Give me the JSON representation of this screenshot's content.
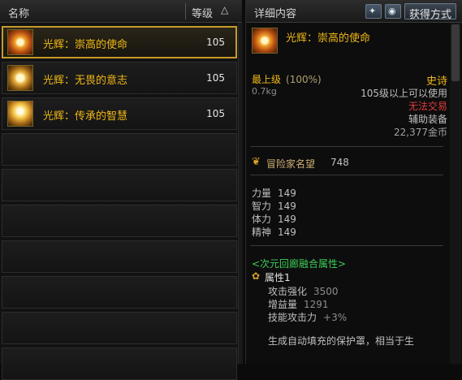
{
  "left_panel": {
    "header": {
      "name_label": "名称",
      "level_label": "等级",
      "sort_arrow": "△"
    },
    "items": [
      {
        "name": "光辉：崇高的使命",
        "level": "105",
        "selected": true
      },
      {
        "name": "光辉：无畏的意志",
        "level": "105",
        "selected": false
      },
      {
        "name": "光辉：传承的智慧",
        "level": "105",
        "selected": false
      }
    ]
  },
  "right_panel": {
    "header": {
      "title": "详细内容",
      "icon1": "compare-icon",
      "icon2": "eye-icon",
      "acquire_label": "获得方式"
    },
    "item": {
      "name": "光辉：崇高的使命",
      "grade": "最上级",
      "grade_pct": "(100%)",
      "weight": "0.7kg",
      "rarity": "史诗",
      "requirement": "105级以上可以使用",
      "trade": "无法交易",
      "type": "辅助装备",
      "price": "22,377金币"
    },
    "fame": {
      "label": "冒险家名望",
      "value": "748"
    },
    "stats": [
      {
        "label": "力量",
        "value": "149"
      },
      {
        "label": "智力",
        "value": "149"
      },
      {
        "label": "体力",
        "value": "149"
      },
      {
        "label": "精神",
        "value": "149"
      }
    ],
    "fusion": {
      "title": "<次元回廊融合属性>",
      "attr_name": "属性1",
      "lines": [
        {
          "label": "攻击强化",
          "value": "3500"
        },
        {
          "label": "增益量",
          "value": "1291"
        },
        {
          "label": "技能攻击力",
          "value": "+3%"
        }
      ],
      "description": "生成自动填充的保护罩，相当于生"
    }
  },
  "colors": {
    "gold": "#f0b814",
    "red": "#e03a3a",
    "green": "#3ecf56",
    "gray": "#bfbfbf",
    "selected_border": "#c79b2a"
  }
}
